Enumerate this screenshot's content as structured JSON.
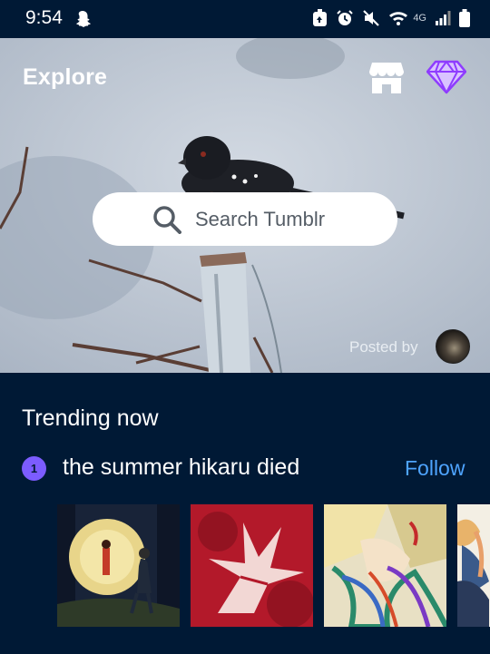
{
  "status_bar": {
    "time": "9:54",
    "icons": [
      "snapchat-ghost-icon",
      "battery-saver-icon",
      "alarm-icon",
      "mute-icon",
      "wifi-icon",
      "4g-icon",
      "signal-icon",
      "battery-icon"
    ],
    "network_label": "4G"
  },
  "header": {
    "title": "Explore",
    "shop_icon": "storefront-icon",
    "premium_icon": "diamond-icon"
  },
  "search": {
    "placeholder": "Search Tumblr"
  },
  "hero": {
    "posted_by_label": "Posted by"
  },
  "trending": {
    "heading": "Trending now",
    "items": [
      {
        "rank": "1",
        "name": "the summer hikaru died",
        "follow_label": "Follow"
      }
    ]
  },
  "colors": {
    "background": "#001935",
    "accent_blue": "#4ea4ff",
    "rank_badge": "#7c5cff",
    "diamond": "#8f3cff"
  }
}
